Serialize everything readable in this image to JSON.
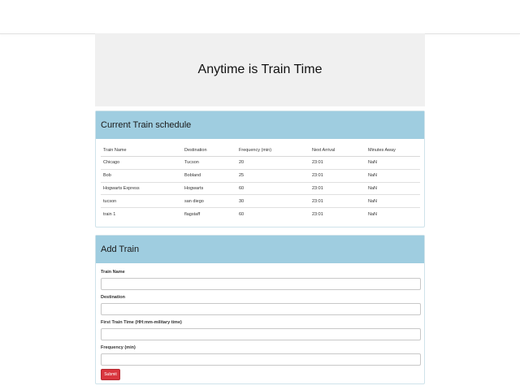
{
  "header": {
    "title": "Anytime is Train Time"
  },
  "schedule": {
    "heading": "Current Train schedule",
    "columns": [
      "Train Name",
      "Destination",
      "Frequency (min)",
      "Next Arrival",
      "Minutes Away"
    ],
    "rows": [
      [
        "Chicago",
        "Tucson",
        "20",
        "23:01",
        "NaN"
      ],
      [
        "Bob",
        "Bobland",
        "25",
        "23:01",
        "NaN"
      ],
      [
        "Hogwarts Express",
        "Hogwarts",
        "60",
        "23:01",
        "NaN"
      ],
      [
        "tucson",
        "san diego",
        "30",
        "23:01",
        "NaN"
      ],
      [
        "train 1",
        "flagstaff",
        "60",
        "23:01",
        "NaN"
      ]
    ]
  },
  "add_train": {
    "heading": "Add Train",
    "fields": [
      {
        "label": "Train Name",
        "value": ""
      },
      {
        "label": "Destination",
        "value": ""
      },
      {
        "label": "First Train Time (HH:mm-military time)",
        "value": ""
      },
      {
        "label": "Frequency (min)",
        "value": ""
      }
    ],
    "submit_label": "Submit"
  },
  "colors": {
    "panel_heading": "#9fcde0",
    "jumbotron": "#f0f0f0",
    "submit": "#d9363e"
  }
}
